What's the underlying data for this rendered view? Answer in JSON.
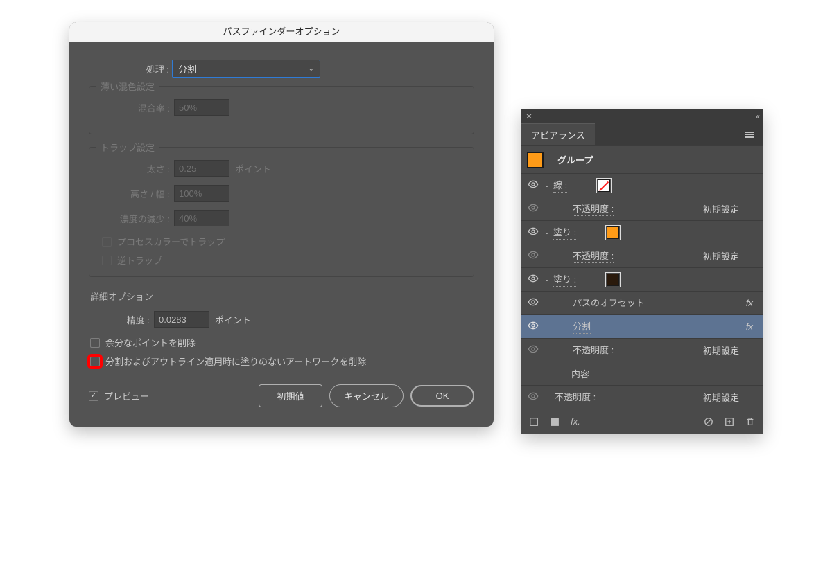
{
  "dialog": {
    "title": "パスファインダーオプション",
    "operation_label": "処理 :",
    "operation_value": "分割",
    "soft_mix": {
      "title": "薄い混色設定",
      "ratio_label": "混合率 :",
      "ratio_value": "50%"
    },
    "trap": {
      "title": "トラップ設定",
      "thickness_label": "太さ :",
      "thickness_value": "0.25",
      "unit": "ポイント",
      "height_label": "高さ / 幅 :",
      "height_value": "100%",
      "reduce_label": "濃度の減少 :",
      "reduce_value": "40%",
      "process_label": "プロセスカラーでトラップ",
      "reverse_label": "逆トラップ"
    },
    "advanced": {
      "title": "詳細オプション",
      "precision_label": "精度 :",
      "precision_value": "0.0283",
      "unit": "ポイント",
      "remove_points_label": "余分なポイントを削除",
      "remove_unfilled_label": "分割およびアウトライン適用時に塗りのないアートワークを削除"
    },
    "preview_label": "プレビュー",
    "defaults": "初期値",
    "cancel": "キャンセル",
    "ok": "OK"
  },
  "panel": {
    "tab": "アピアランス",
    "group_label": "グループ",
    "rows": {
      "stroke_label": "線 :",
      "opacity_label": "不透明度 :",
      "opacity_value": "初期設定",
      "fill_label": "塗り :",
      "offset_label": "パスのオフセット",
      "divide_label": "分割",
      "contents_label": "内容"
    }
  }
}
